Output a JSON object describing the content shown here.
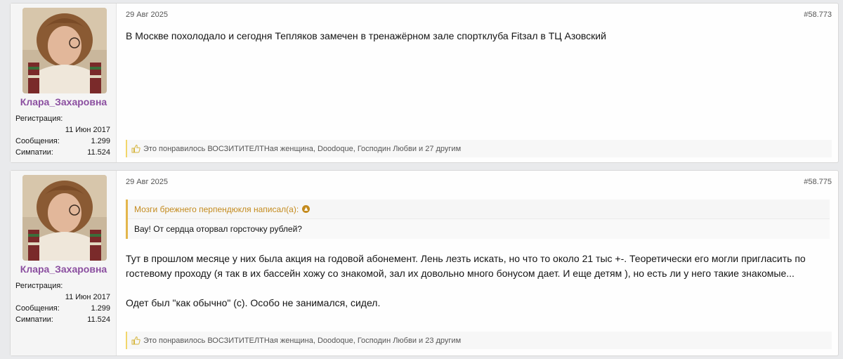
{
  "posts": [
    {
      "author": {
        "name": "Клара_Захаровна",
        "reg_label": "Регистрация:",
        "reg_date": "11 Июн 2017",
        "messages_label": "Сообщения:",
        "messages": "1.299",
        "sympathy_label": "Симпатии:",
        "sympathy": "11.524"
      },
      "date": "29 Авг 2025",
      "number": "#58.773",
      "text": "В Москве похолодало и сегодня Тепляков замечен в тренажёрном зале спортклуба Fitзал в ТЦ Азовский",
      "likes": "Это понравилось ВОСЗИТИТЕЛТНая женщина, Doodoque, Господин Любви и 27 другим"
    },
    {
      "author": {
        "name": "Клара_Захаровна",
        "reg_label": "Регистрация:",
        "reg_date": "11 Июн 2017",
        "messages_label": "Сообщения:",
        "messages": "1.299",
        "sympathy_label": "Симпатии:",
        "sympathy": "11.524"
      },
      "date": "29 Авг 2025",
      "number": "#58.775",
      "quote": {
        "author": "Мозги брежнего перпендюкля написал(а):",
        "text": "Вау! От сердца оторвал горсточку рублей?"
      },
      "text_p1": "Тут в прошлом месяце у них была акция на годовой абонемент. Лень лезть искать, но что то около 21 тыс +-. Теоретически его могли пригласить по гостевому проходу (я так в их бассейн хожу со знакомой, зал их довольно много бонусом дает. И еще детям ), но есть ли у него такие знакомые...",
      "text_p2": "Одет был \"как обычно\" (с). Особо не занимался, сидел.",
      "likes": "Это понравилось ВОСЗИТИТЕЛТНая женщина, Doodoque, Господин Любви и 23 другим"
    }
  ],
  "colors": {
    "username": "#8b4fa0",
    "quote_accent": "#c48b1e",
    "like_accent": "#f2d66b"
  }
}
